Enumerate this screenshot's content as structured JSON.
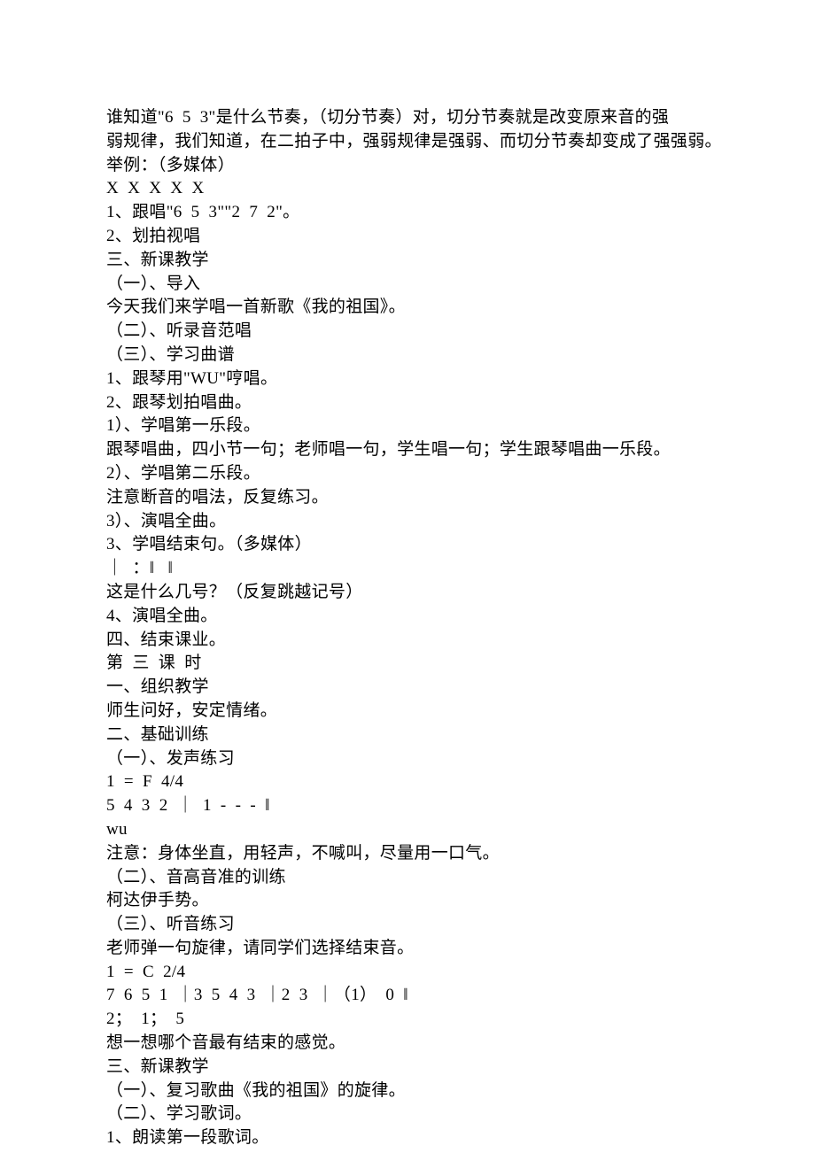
{
  "lines": [
    "谁知道\"6  5  3\"是什么节奏，（切分节奏）对，切分节奏就是改变原来音的强",
    "弱规律，我们知道，在二拍子中，强弱规律是强弱、而切分节奏却变成了强强弱。",
    "举例：（多媒体）",
    "X  X  X  X  X",
    "1、跟唱\"6  5  3\"\"2  7  2\"。",
    "2、划拍视唱",
    "三、新课教学",
    "（一）、导入",
    "今天我们来学唱一首新歌《我的祖国》。",
    "（二）、听录音范唱",
    "（三）、学习曲谱",
    "1、跟琴用\"WU\"哼唱。",
    "2、跟琴划拍唱曲。",
    "1）、学唱第一乐段。",
    "跟琴唱曲，四小节一句；老师唱一句，学生唱一句；学生跟琴唱曲一乐段。",
    "2）、学唱第二乐段。",
    "注意断音的唱法，反复练习。",
    "3）、演唱全曲。",
    "3、学唱结束句。（多媒体）",
    "｜  ：‖   ‖",
    "这是什么几号？（反复跳越记号）",
    "4、演唱全曲。",
    "四、结束课业。",
    "第  三  课  时",
    "一、组织教学",
    "师生问好，安定情绪。",
    "二、基础训练",
    "（一）、发声练习",
    "1  =  F  4/4",
    "5  4  3  2  ｜  1  -  -  -  ‖",
    "wu",
    "注意：身体坐直，用轻声，不喊叫，尽量用一口气。",
    "（二）、音高音准的训练",
    "柯达伊手势。",
    "（三）、听音练习",
    "老师弹一句旋律，请同学们选择结束音。",
    "1  =  C  2/4",
    "7  6  5  1  ｜3  5  4  3  ｜2  3  ｜（1）  0  ‖",
    "2；  1；  5",
    "想一想哪个音最有结束的感觉。",
    "三、新课教学",
    "（一）、复习歌曲《我的祖国》的旋律。",
    "（二）、学习歌词。",
    "1、朗读第一段歌词。"
  ]
}
